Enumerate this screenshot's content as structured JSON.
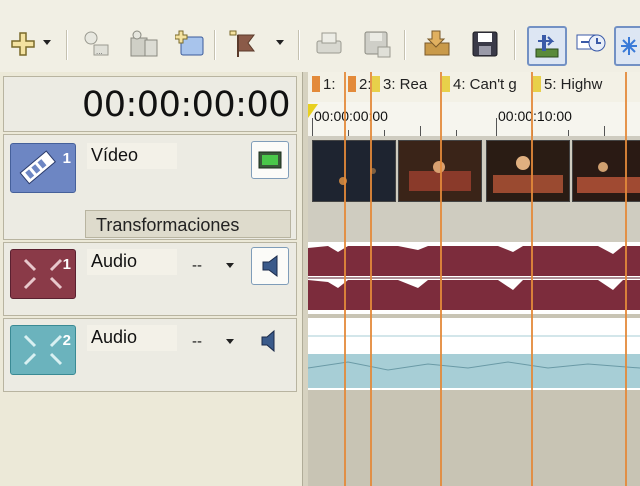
{
  "toolbar": {
    "buttons": [
      {
        "icon": "add-track-icon"
      },
      {
        "icon": "insert-icon"
      },
      {
        "icon": "film-reel-icon"
      },
      {
        "icon": "new-folder-icon"
      },
      {
        "icon": "marker-flag-icon"
      },
      {
        "icon": "print-icon"
      },
      {
        "icon": "save-as-icon"
      },
      {
        "icon": "import-media-icon"
      },
      {
        "icon": "save-icon"
      },
      {
        "icon": "snap-icon"
      },
      {
        "icon": "auto-ripple-icon"
      },
      {
        "icon": "sparkle-icon"
      }
    ]
  },
  "timecode": "00:00:00:00",
  "tracks": [
    {
      "num": "1",
      "name": "Vídeo",
      "subtab": "Transformaciones"
    },
    {
      "num": "1",
      "name": "Audio",
      "dashes": "--"
    },
    {
      "num": "2",
      "name": "Audio",
      "dashes": "--"
    }
  ],
  "markers": [
    {
      "label": "1:"
    },
    {
      "label": "2:"
    },
    {
      "label": "3: Rea"
    },
    {
      "label": "4: Can't g"
    },
    {
      "label": "5: Highw"
    }
  ],
  "ruler": {
    "labels": [
      "00:00:00:00",
      "00:00:10:00"
    ]
  },
  "colors": {
    "video_track": "#6d86c3",
    "audio1_track": "#8a3a48",
    "audio2_track": "#6bb3bd",
    "marker_line": "#e38a3a",
    "waveform1": "#7c2c3c",
    "waveform2": "#a7ced6"
  }
}
